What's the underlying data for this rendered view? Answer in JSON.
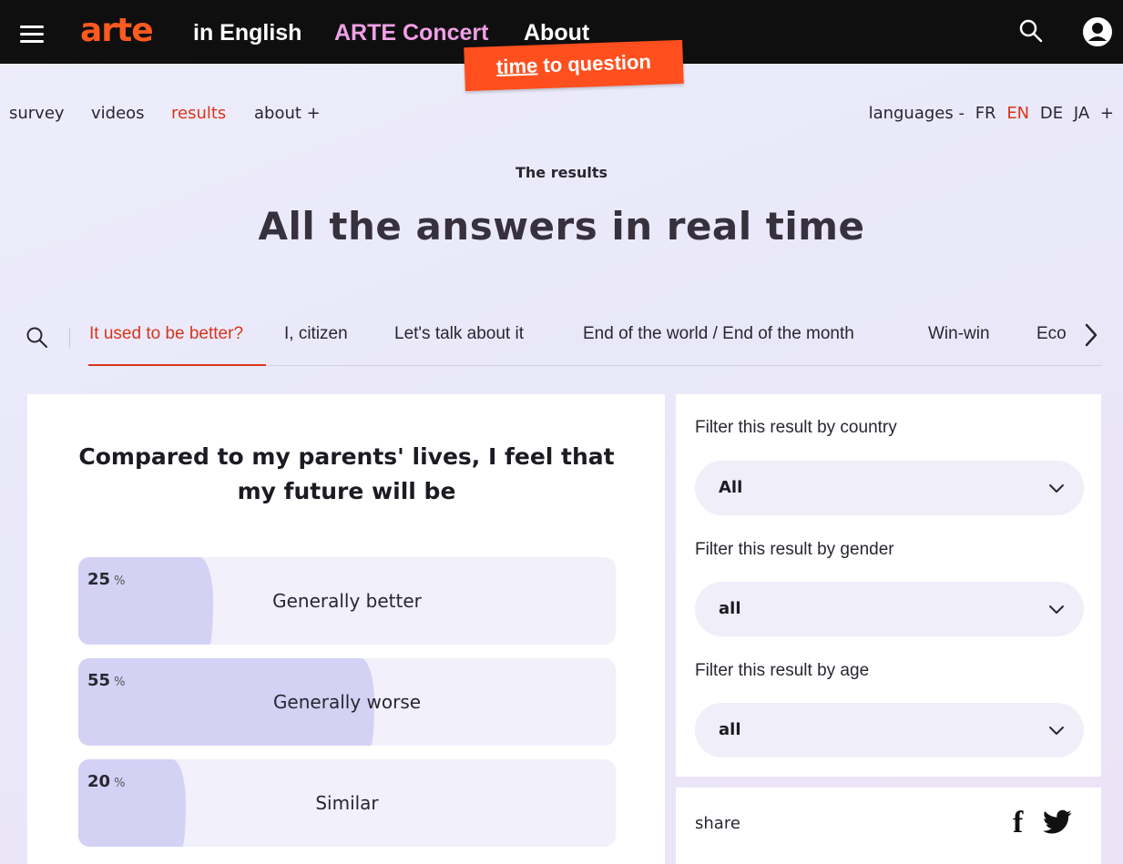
{
  "header": {
    "logo": "arte",
    "edition": "in English",
    "concert": "ARTE Concert",
    "about": "About",
    "banner_word1": "time",
    "banner_rest": "to question",
    "icons": [
      "menu-icon",
      "search-icon",
      "user-icon"
    ]
  },
  "subnav": {
    "items": [
      "survey",
      "videos",
      "results",
      "about +"
    ],
    "active": "results",
    "languages_label": "languages -",
    "languages": [
      "FR",
      "EN",
      "DE",
      "JA",
      "+"
    ],
    "active_language": "EN"
  },
  "page": {
    "eyebrow": "The results",
    "title": "All the answers in real time"
  },
  "tabs": {
    "items": [
      "It used to be better?",
      "I, citizen",
      "Let's talk about it",
      "End of the world / End of the month",
      "Win-win",
      "Eco"
    ],
    "active": "It used to be better?"
  },
  "question": {
    "title": "Compared to my parents' lives, I feel that my future will be",
    "answers": [
      {
        "value": "25",
        "unit": "%",
        "label": "Generally better",
        "fraction": 0.25
      },
      {
        "value": "55",
        "unit": "%",
        "label": "Generally worse",
        "fraction": 0.55
      },
      {
        "value": "20",
        "unit": "%",
        "label": "Similar",
        "fraction": 0.2
      }
    ]
  },
  "filters": {
    "country_label": "Filter this result by country",
    "country_value": "All",
    "gender_label": "Filter this result by gender",
    "gender_value": "all",
    "age_label": "Filter this result by age",
    "age_value": "all"
  },
  "share": {
    "label": "share",
    "facebook": "f"
  },
  "colors": {
    "accent": "#d8351c",
    "banner": "#ff4f1f",
    "concert": "#f0a0e6",
    "bar_fill": "#d3d2f4",
    "bar_track": "#f1f0fb"
  }
}
